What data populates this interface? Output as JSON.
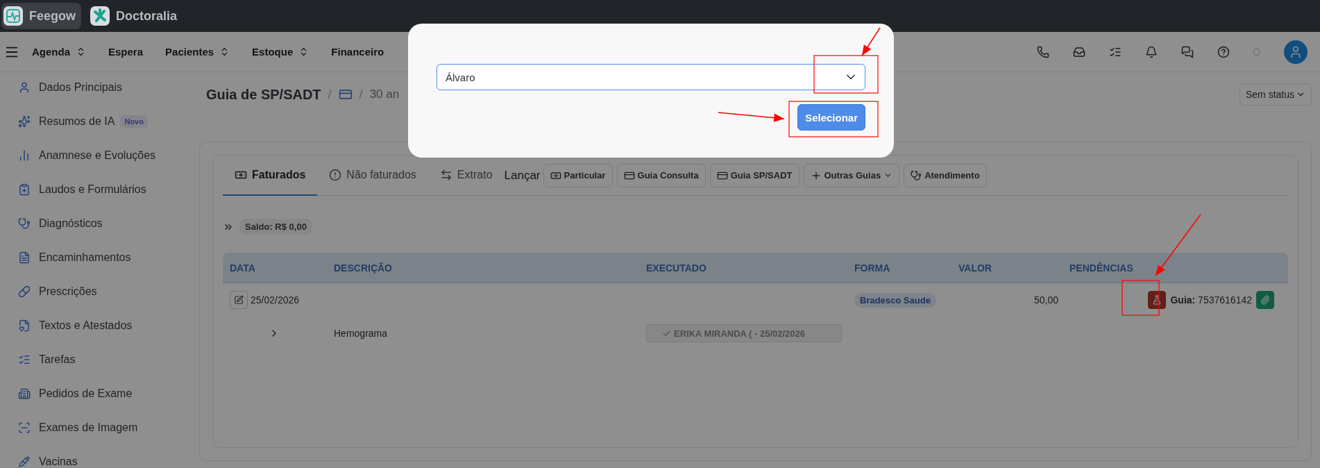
{
  "app_bar": {
    "tabs": [
      {
        "label": "Feegow",
        "selected": true
      },
      {
        "label": "Doctoralia",
        "selected": false
      }
    ]
  },
  "nav": {
    "items": [
      {
        "label": "Agenda",
        "dropdown": true
      },
      {
        "label": "Espera",
        "dropdown": false
      },
      {
        "label": "Pacientes",
        "dropdown": true
      },
      {
        "label": "Estoque",
        "dropdown": true
      },
      {
        "label": "Financeiro",
        "dropdown": false
      }
    ]
  },
  "sidebar": {
    "items": [
      {
        "label": "Dados Principais"
      },
      {
        "label": "Resumos de IA",
        "badge": "Novo"
      },
      {
        "label": "Anamnese e Evoluções"
      },
      {
        "label": "Laudos e Formulários"
      },
      {
        "label": "Diagnósticos"
      },
      {
        "label": "Encaminhamentos"
      },
      {
        "label": "Prescrições"
      },
      {
        "label": "Textos e Atestados"
      },
      {
        "label": "Tarefas"
      },
      {
        "label": "Pedidos de Exame"
      },
      {
        "label": "Exames de Imagem"
      },
      {
        "label": "Vacinas"
      }
    ]
  },
  "page": {
    "title": "Guia de SP/SADT",
    "separators": [
      "/",
      "/"
    ],
    "breadcrumb": "30 an",
    "status_button": "Sem status"
  },
  "tabs": [
    {
      "label": "Faturados",
      "selected": true
    },
    {
      "label": "Não faturados",
      "selected": false
    },
    {
      "label": "Extrato",
      "selected": false
    }
  ],
  "launch": {
    "label": "Lançar",
    "buttons": [
      {
        "label": "Particular",
        "dropdown": false
      },
      {
        "label": "Guia Consulta",
        "dropdown": false
      },
      {
        "label": "Guia SP/SADT",
        "dropdown": false
      },
      {
        "label": "Outras Guias",
        "dropdown": true
      },
      {
        "label": "Atendimento",
        "dropdown": false
      }
    ]
  },
  "balance": "Saldo: R$ 0,00",
  "table": {
    "columns": [
      "DATA",
      "DESCRIÇÃO",
      "EXECUTADO",
      "FORMA",
      "VALOR",
      "PENDÊNCIAS"
    ],
    "rows": [
      {
        "date": "25/02/2026",
        "form": "Bradesco Saude",
        "value": "50,00",
        "guide": "**Guia:** 7537616142",
        "items": [
          {
            "description": "Hemograma",
            "executed": "ERIKA MIRANDA ( - 25/02/2026"
          }
        ]
      }
    ]
  },
  "modal": {
    "select_value": "Álvaro",
    "button": "Selecionar"
  }
}
